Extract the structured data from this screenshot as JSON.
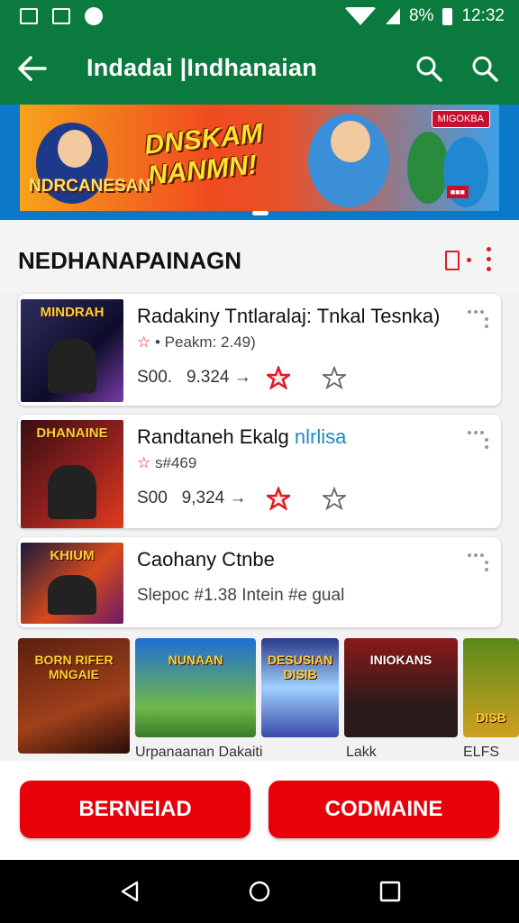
{
  "status_bar": {
    "battery": "8%",
    "time": "12:32"
  },
  "app_bar": {
    "title": "Indadai |Indhanaian"
  },
  "banner": {
    "title_line1": "DNSKAM",
    "title_line2": "NANMN!",
    "subtitle": "NDRCANESAN",
    "tag": "MIGOKBA"
  },
  "section": {
    "title": "NEDHANAPAINAGN"
  },
  "cards": [
    {
      "thumb_label": "MINDRAH",
      "title": "Radakiny Tntlaralaj: Tnkal Tesnka)",
      "subtitle": "• Peakm: 2.49)",
      "price": "S00.",
      "price_value": "9.324 →",
      "colors": [
        "#2d2d5e",
        "#0d0d2a",
        "#7a3aa8"
      ]
    },
    {
      "thumb_label": "DHANAINE",
      "title": "Randtaneh Ekalg",
      "title_accent": "nlrlisa",
      "subtitle": "s#469",
      "price": "S00",
      "price_value": "9,324 →",
      "colors": [
        "#3a1010",
        "#8a1e1e",
        "#e23a1e"
      ]
    },
    {
      "thumb_label": "KHIUM",
      "title": "Caohany Ctnbe",
      "subtitle": "Slepoc #1.38 Intein #e gual",
      "colors": [
        "#1a1a3e",
        "#d84a1a",
        "#6a1a6a"
      ]
    }
  ],
  "grid": [
    {
      "label": "BORN RIFER MNGAIE",
      "caption": "",
      "colors": [
        "#5a1f10",
        "#a0401a"
      ]
    },
    {
      "label": "NUNAAN",
      "caption": "Urpanaanan Dakaiti",
      "colors": [
        "#1f6fd6",
        "#6fb84a"
      ]
    },
    {
      "label": "DESUSIAN DISIB",
      "caption": "",
      "colors": [
        "#2a3a8a",
        "#9fd0ff"
      ]
    },
    {
      "label": "INIOKANS",
      "caption": "Lakk",
      "colors": [
        "#8a1a1a",
        "#2a1a1a"
      ]
    },
    {
      "label": "DISB",
      "caption": "ELFS",
      "colors": [
        "#5a8a1a",
        "#d0a020"
      ]
    }
  ],
  "actions": {
    "left": "BERNEIAD",
    "right": "CODMAINE"
  },
  "theme": {
    "primary": "#0b7a3e",
    "accent": "#e8000b"
  }
}
